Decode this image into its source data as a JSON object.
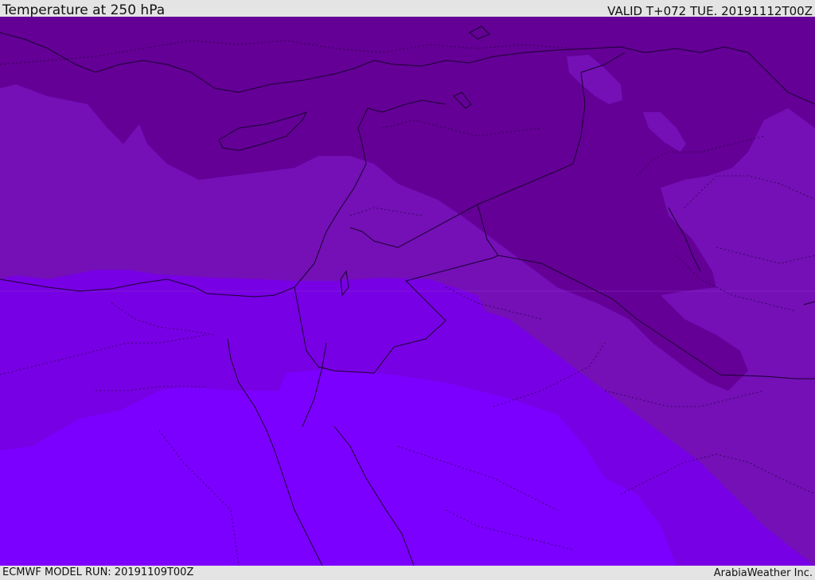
{
  "header": {
    "title": "Temperature at 250 hPa",
    "valid_time": "VALID T+072 TUE. 20191112T00Z"
  },
  "footer": {
    "model_run": "ECMWF MODEL RUN: 20191109T00Z",
    "credit": "ArabiaWeather Inc."
  },
  "map": {
    "colors": {
      "band_coldest": "#640096",
      "band_cold": "#7410b6",
      "band_mid": "#7800e4",
      "band_warm": "#7c00ff",
      "border_line": "#1a0030"
    }
  }
}
